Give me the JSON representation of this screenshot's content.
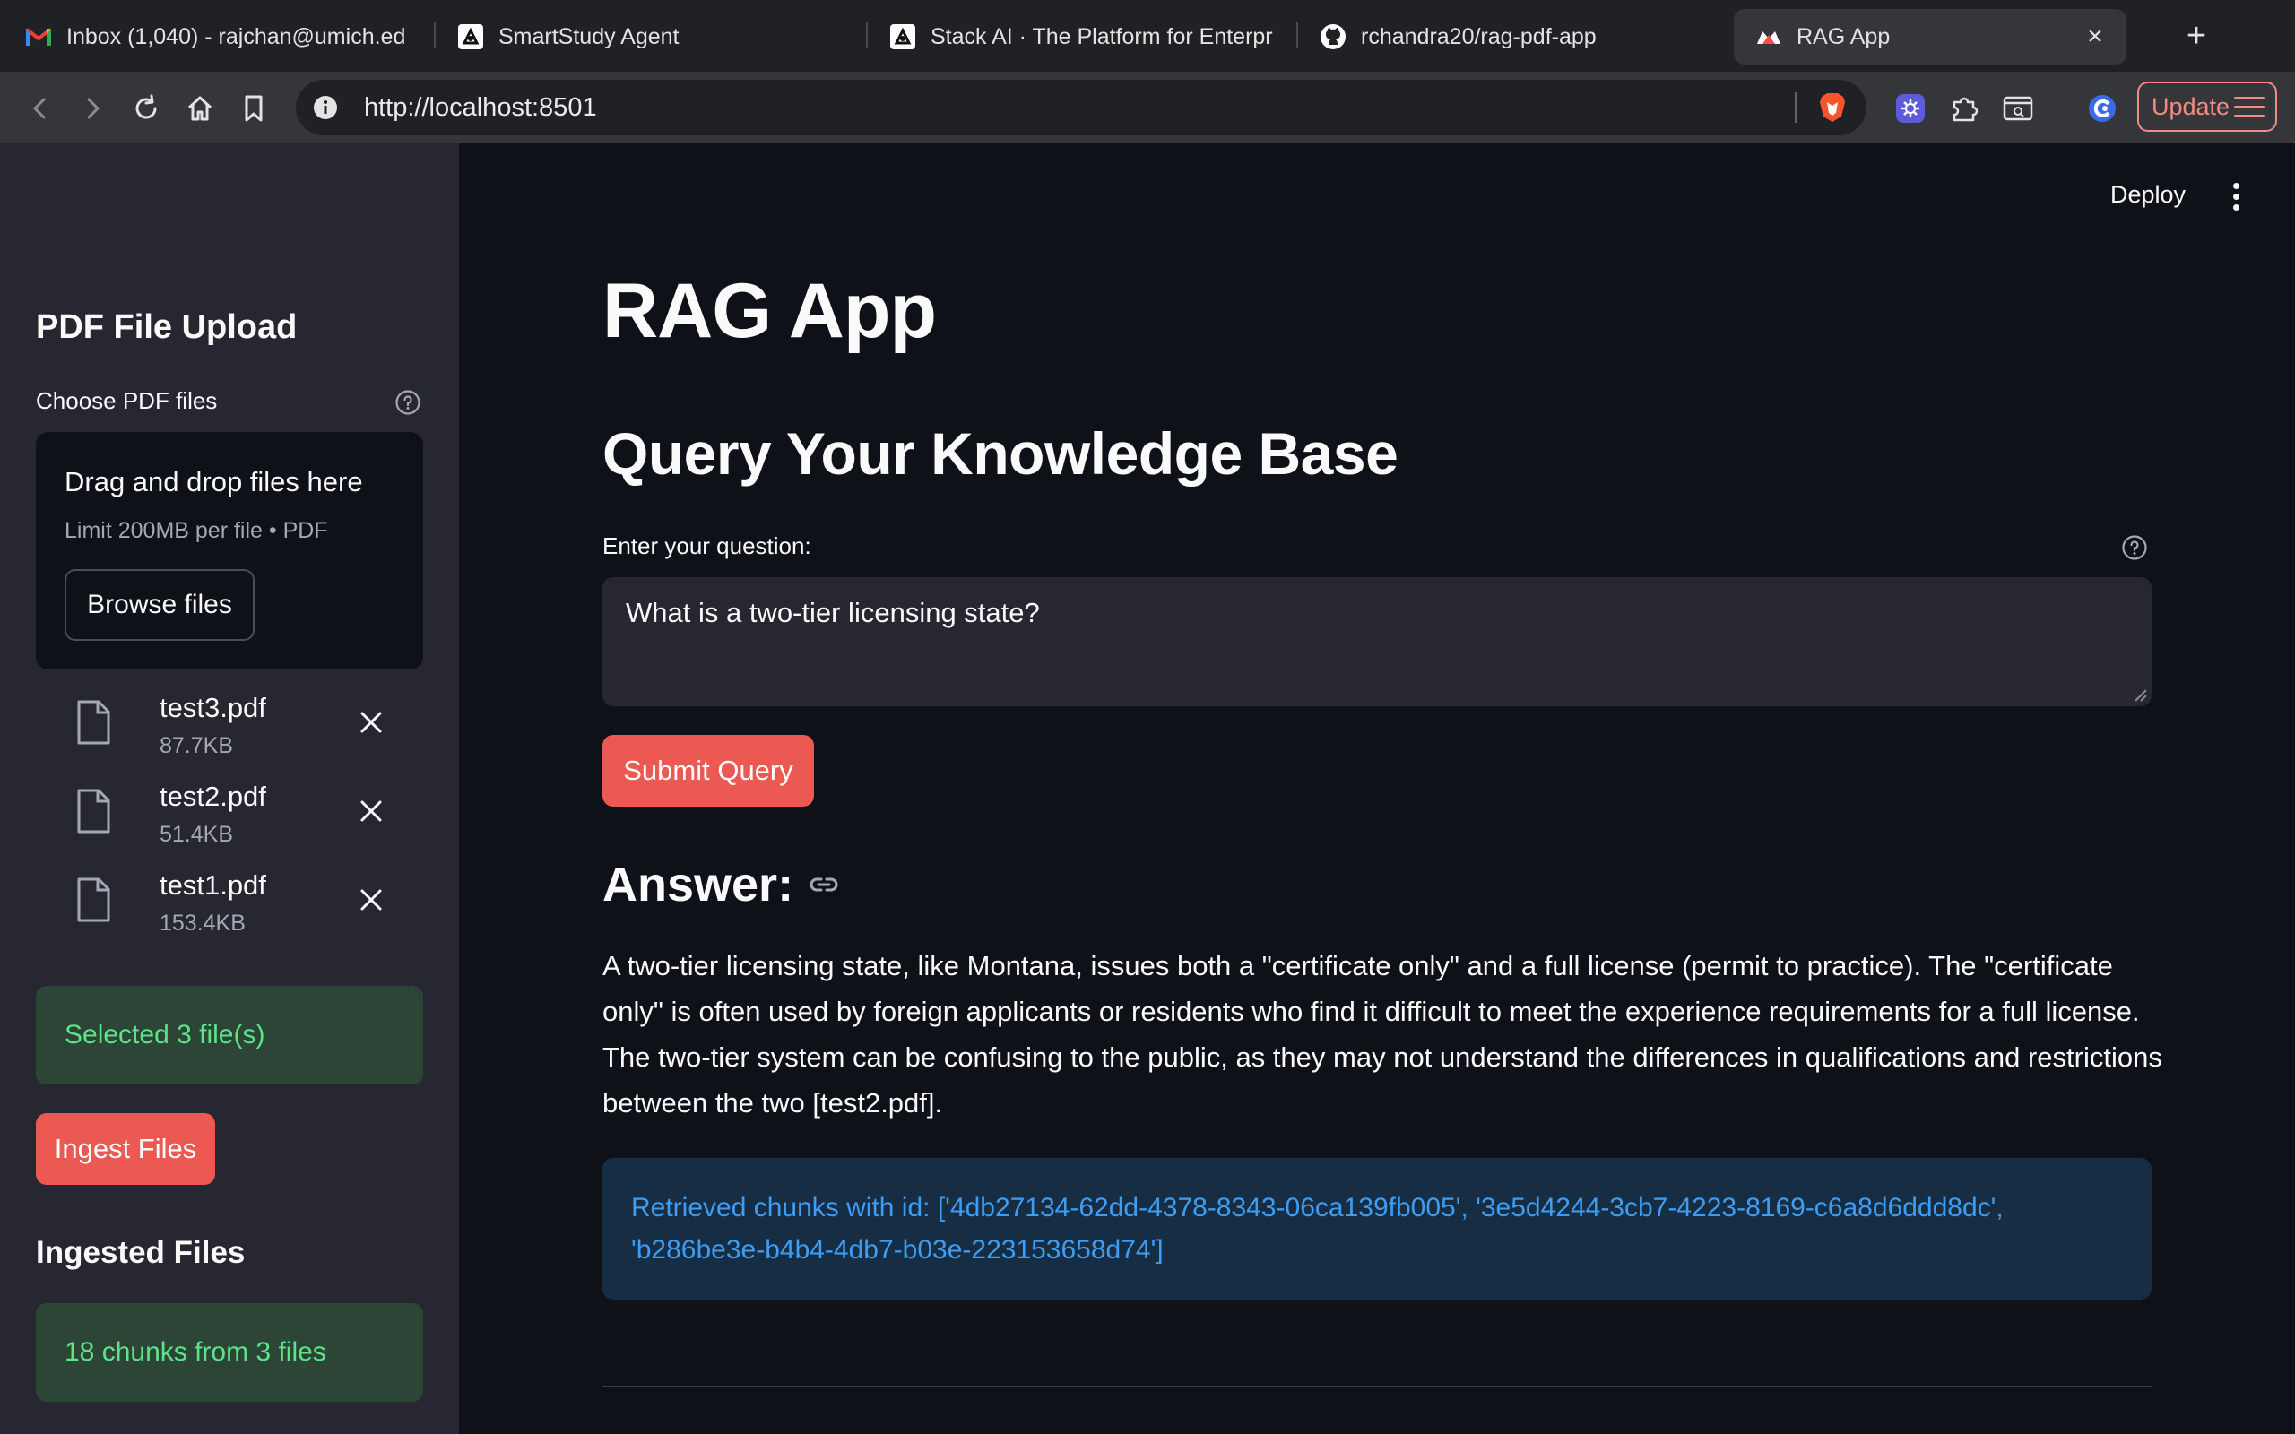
{
  "browser": {
    "tabs": [
      {
        "title": "Inbox (1,040) - rajchan@umich.ed",
        "icon": "gmail-icon"
      },
      {
        "title": "SmartStudy Agent",
        "icon": "stackai-icon"
      },
      {
        "title": "Stack AI · The Platform for Enterpr",
        "icon": "stackai-icon"
      },
      {
        "title": "rchandra20/rag-pdf-app",
        "icon": "github-icon"
      },
      {
        "title": "RAG App",
        "icon": "streamlit-icon",
        "active": true
      }
    ],
    "url": "http://localhost:8501",
    "update_label": "Update"
  },
  "sidebar": {
    "upload_heading": "PDF File Upload",
    "choose_label": "Choose PDF files",
    "dropzone_title": "Drag and drop files here",
    "dropzone_limit": "Limit 200MB per file • PDF",
    "browse_label": "Browse files",
    "files": [
      {
        "name": "test3.pdf",
        "size": "87.7KB"
      },
      {
        "name": "test2.pdf",
        "size": "51.4KB"
      },
      {
        "name": "test1.pdf",
        "size": "153.4KB"
      }
    ],
    "selected_message": "Selected 3 file(s)",
    "ingest_label": "Ingest Files",
    "ingested_heading": "Ingested Files",
    "ingested_message": "18 chunks from 3 files"
  },
  "main": {
    "deploy_label": "Deploy",
    "title": "RAG App",
    "section_title": "Query Your Knowledge Base",
    "question_label": "Enter your question:",
    "question_value": "What is a two-tier licensing state?",
    "submit_label": "Submit Query",
    "answer_heading": "Answer:",
    "answer_text": "A two-tier licensing state, like Montana, issues both a \"certificate only\" and a full license (permit to practice). The \"certificate only\" is often used by foreign applicants or residents who find it difficult to meet the experience requirements for a full license. The two-tier system can be confusing to the public, as they may not understand the differences in qualifications and restrictions between the two [test2.pdf].",
    "retrieved_text": "Retrieved chunks with id: ['4db27134-62dd-4378-8343-06ca139fb005', '3e5d4244-3cb7-4223-8169-c6a8d6ddd8dc', 'b286be3e-b4b4-4db7-b03e-223153658d74']"
  },
  "colors": {
    "accent": "#ec5952",
    "success_bg": "#2d4537",
    "success_text": "#5ce488",
    "info_bg": "#172d43",
    "info_text": "#3d9df3",
    "sidebar_bg": "#262730",
    "main_bg": "#0e1117"
  }
}
